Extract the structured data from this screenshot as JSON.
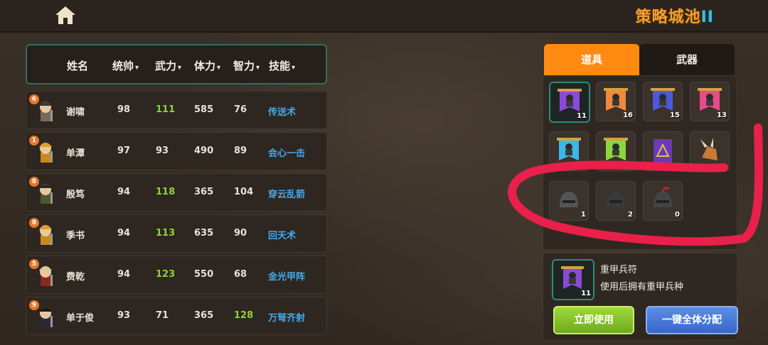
{
  "header": {
    "logo_main": "策略城池",
    "logo_sub": "II"
  },
  "columns": [
    "姓名",
    "统帅",
    "武力",
    "体力",
    "智力",
    "技能"
  ],
  "sort_arrow": "▾",
  "heroes": [
    {
      "level": "6",
      "name": "谢啸",
      "lead": "98",
      "force": "111",
      "hp": "585",
      "intel": "76",
      "skill": "传送术",
      "force_green": true,
      "intel_green": false,
      "body": "#7a6a55",
      "hat": "#3a3a3a"
    },
    {
      "level": "1",
      "name": "单潭",
      "lead": "97",
      "force": "93",
      "hp": "490",
      "intel": "89",
      "skill": "会心一击",
      "force_green": false,
      "intel_green": false,
      "body": "#c88a1a",
      "hat": "#e0a020"
    },
    {
      "level": "8",
      "name": "殷笃",
      "lead": "94",
      "force": "118",
      "hp": "365",
      "intel": "104",
      "skill": "穿云乱箭",
      "force_green": true,
      "intel_green": false,
      "body": "#4a5a2a",
      "hat": "#2a2a2a"
    },
    {
      "level": "8",
      "name": "季书",
      "lead": "94",
      "force": "113",
      "hp": "635",
      "intel": "90",
      "skill": "回天术",
      "force_green": true,
      "intel_green": false,
      "body": "#c88a1a",
      "hat": "#e0a020"
    },
    {
      "level": "5",
      "name": "费乾",
      "lead": "94",
      "force": "123",
      "hp": "550",
      "intel": "68",
      "skill": "金光甲阵",
      "force_green": true,
      "intel_green": false,
      "body": "#8a2a1a",
      "hat": "#d8c8a0"
    },
    {
      "level": "9",
      "name": "单于俊",
      "lead": "93",
      "force": "71",
      "hp": "365",
      "intel": "128",
      "skill": "万弩齐射",
      "force_green": false,
      "intel_green": true,
      "body": "#2a2a3a",
      "hat": "#1a1a1a"
    }
  ],
  "tabs": {
    "items": "道具",
    "weapons": "武器"
  },
  "item_slots": [
    {
      "count": "11",
      "color": "#8a4ad8",
      "selected": true,
      "icon": "purple-banner-icon"
    },
    {
      "count": "16",
      "color": "#f08a3a",
      "selected": false,
      "icon": "orange-banner-icon"
    },
    {
      "count": "15",
      "color": "#4a5ad8",
      "selected": false,
      "icon": "blue-banner-icon"
    },
    {
      "count": "13",
      "color": "#e84a8a",
      "selected": false,
      "icon": "pink-banner-icon"
    },
    {
      "count": "",
      "color": "#3ab8e8",
      "selected": false,
      "icon": "cyan-banner-icon"
    },
    {
      "count": "",
      "color": "#8ad83a",
      "selected": false,
      "icon": "green-banner-icon"
    },
    {
      "count": "",
      "color": "#6a3ab8",
      "selected": false,
      "icon": "spellbook-icon"
    },
    {
      "count": "",
      "color": "#e8d8b8",
      "selected": false,
      "icon": "winged-boot-icon"
    },
    {
      "count": "1",
      "color": "#555555",
      "selected": false,
      "icon": "iron-helmet-icon"
    },
    {
      "count": "2",
      "color": "#3a3a3a",
      "selected": false,
      "icon": "winged-helmet-icon"
    },
    {
      "count": "0",
      "color": "#444444",
      "selected": false,
      "icon": "knight-helmet-icon"
    }
  ],
  "detail": {
    "name": "重甲兵符",
    "desc": "使用后拥有重甲兵种",
    "count": "11"
  },
  "buttons": {
    "use": "立即使用",
    "distribute": "一键全体分配"
  },
  "colors": {
    "accent": "#ff8a12",
    "stat_green": "#8fd23a",
    "skill_blue": "#45a8e8",
    "annotation": "#e8204a"
  }
}
